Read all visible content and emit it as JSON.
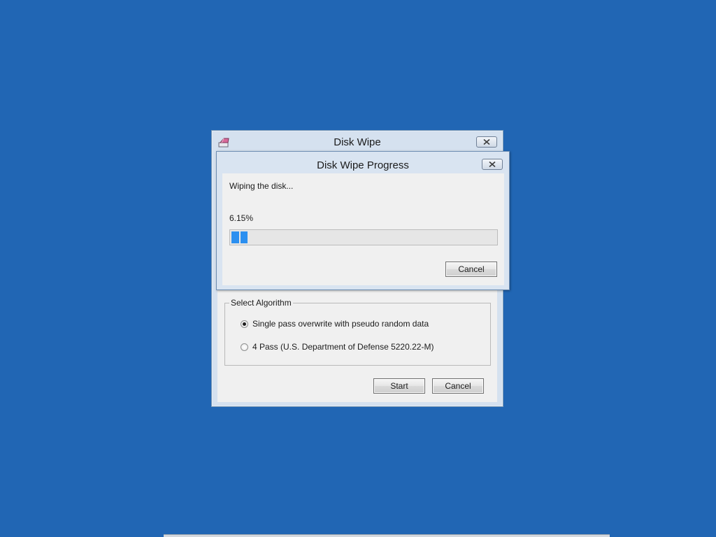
{
  "main_window": {
    "title": "Disk Wipe",
    "icon": "eraser-icon",
    "algorithm_group": {
      "label": "Select Algorithm",
      "options": [
        {
          "label": "Single pass overwrite with pseudo random data",
          "selected": true
        },
        {
          "label": "4 Pass (U.S. Department of Defense 5220.22-M)",
          "selected": false
        }
      ]
    },
    "start_label": "Start",
    "cancel_label": "Cancel"
  },
  "progress_window": {
    "title": "Disk Wipe Progress",
    "status": "Wiping the disk...",
    "percent_text": "6.15%",
    "progress_fraction": 0.0615,
    "cancel_label": "Cancel"
  },
  "colors": {
    "desktop": "#2166b4",
    "progress_fill": "#2b8ff0"
  }
}
